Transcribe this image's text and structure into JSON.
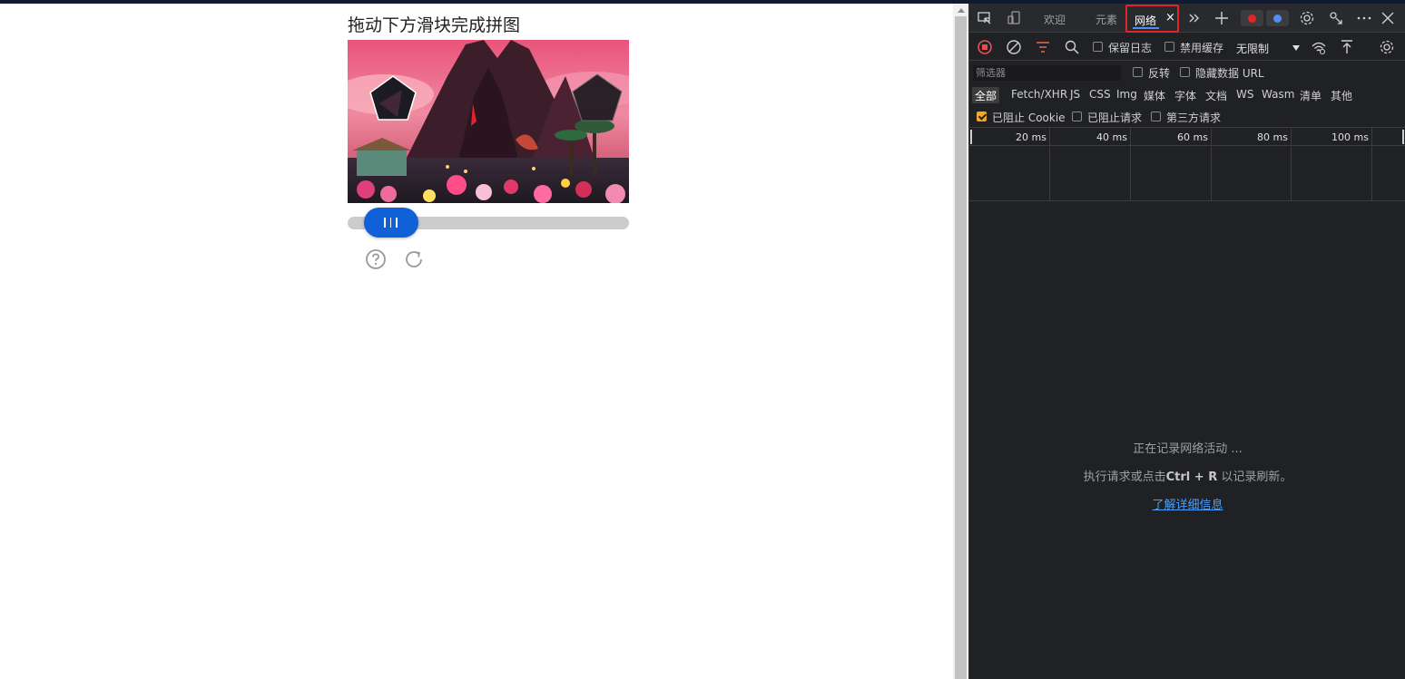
{
  "page": {
    "captcha": {
      "title": "拖动下方滑块完成拼图",
      "slider_position_fraction": 0.07
    }
  },
  "devtools": {
    "tabs": {
      "welcome": "欢迎",
      "elements": "元素",
      "network": "网络",
      "close": "×"
    },
    "toolbar": {
      "preserve_log": "保留日志",
      "disable_cache": "禁用缓存",
      "throttling": "无限制"
    },
    "filter": {
      "placeholder": "筛选器",
      "invert": "反转",
      "hide_data_urls": "隐藏数据 URL"
    },
    "types": {
      "all": "全部",
      "fetch_xhr": "Fetch/XHR",
      "js": "JS",
      "css": "CSS",
      "img": "Img",
      "media": "媒体",
      "font": "字体",
      "doc": "文档",
      "ws": "WS",
      "wasm": "Wasm",
      "manifest": "清单",
      "other": "其他"
    },
    "blocked": {
      "blocked_cookies": "已阻止 Cookie",
      "blocked_requests": "已阻止请求",
      "third_party": "第三方请求"
    },
    "timeline": {
      "ticks": [
        "20 ms",
        "40 ms",
        "60 ms",
        "80 ms",
        "100 ms"
      ]
    },
    "empty_state": {
      "line1": "正在记录网络活动 ...",
      "line2_before": "执行请求或点击",
      "line2_shortcut": "Ctrl + R",
      "line2_after": " 以记录刷新。",
      "link": "了解详细信息"
    },
    "colors": {
      "accent_blue": "#4d8ef8",
      "highlight_red": "#e0262a",
      "checkbox_on": "#f4a825"
    }
  }
}
